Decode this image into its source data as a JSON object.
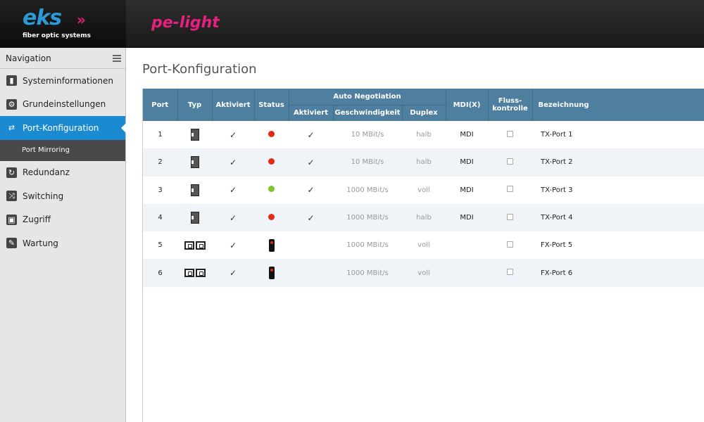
{
  "header": {
    "logo_text": "eks",
    "logo_chevrons": "»",
    "logo_subtitle": "fiber optic systems",
    "brand": "pe-light"
  },
  "sidebar": {
    "title": "Navigation",
    "items": [
      {
        "label": "Systeminformationen",
        "icon": "chart-icon"
      },
      {
        "label": "Grundeinstellungen",
        "icon": "gear-icon"
      },
      {
        "label": "Port-Konfiguration",
        "icon": "port-icon",
        "active": true
      },
      {
        "label": "Redundanz",
        "icon": "redundancy-icon"
      },
      {
        "label": "Switching",
        "icon": "shuffle-icon"
      },
      {
        "label": "Zugriff",
        "icon": "lock-icon"
      },
      {
        "label": "Wartung",
        "icon": "wrench-icon"
      }
    ],
    "sub_item": "Port Mirroring"
  },
  "page": {
    "title": "Port-Konfiguration"
  },
  "table": {
    "headers": {
      "port": "Port",
      "typ": "Typ",
      "aktiviert": "Aktiviert",
      "status": "Status",
      "auto_neg": "Auto Negotiation",
      "an_aktiviert": "Aktiviert",
      "geschwindigkeit": "Geschwindigkeit",
      "duplex": "Duplex",
      "mdix": "MDI(X)",
      "fluss_1": "Fluss-",
      "fluss_2": "kontrolle",
      "bezeichnung": "Bezeichnung"
    },
    "rows": [
      {
        "port": "1",
        "typ": "tx",
        "aktiviert": true,
        "status": "red",
        "an": true,
        "speed": "10 MBit/s",
        "duplex": "halb",
        "mdi": "MDI",
        "fluss": false,
        "name": "TX-Port 1"
      },
      {
        "port": "2",
        "typ": "tx",
        "aktiviert": true,
        "status": "red",
        "an": true,
        "speed": "10 MBit/s",
        "duplex": "halb",
        "mdi": "MDI",
        "fluss": false,
        "name": "TX-Port 2"
      },
      {
        "port": "3",
        "typ": "tx",
        "aktiviert": true,
        "status": "green",
        "an": true,
        "speed": "1000 MBit/s",
        "duplex": "voll",
        "mdi": "MDI",
        "fluss": false,
        "name": "TX-Port 3"
      },
      {
        "port": "4",
        "typ": "tx",
        "aktiviert": true,
        "status": "red",
        "an": true,
        "speed": "1000 MBit/s",
        "duplex": "halb",
        "mdi": "MDI",
        "fluss": false,
        "name": "TX-Port 4"
      },
      {
        "port": "5",
        "typ": "fx",
        "aktiviert": true,
        "status": "lamp",
        "an": false,
        "speed": "1000 MBit/s",
        "duplex": "voll",
        "mdi": "",
        "fluss": false,
        "name": "FX-Port 5"
      },
      {
        "port": "6",
        "typ": "fx",
        "aktiviert": true,
        "status": "lamp",
        "an": false,
        "speed": "1000 MBit/s",
        "duplex": "voll",
        "mdi": "",
        "fluss": false,
        "name": "FX-Port 6"
      }
    ]
  },
  "colors": {
    "accent": "#1c8ad1",
    "table_header": "#4f7f9f",
    "status_red": "#e32a12",
    "status_green": "#7bc82a",
    "brand_pink": "#e5207e"
  }
}
